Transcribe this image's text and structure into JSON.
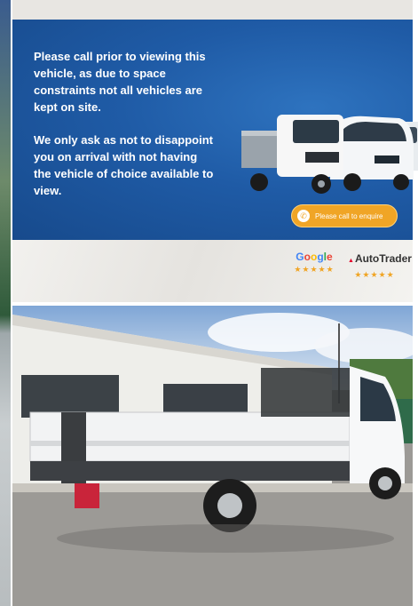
{
  "banner": {
    "paragraph_1": "Please call prior to viewing this vehicle, as due to space constraints not all vehicles are kept on site.",
    "paragraph_2": "We only ask as not to disappoint you on arrival with not having the vehicle of choice available to view.",
    "enquire_button": "Please call to enquire",
    "background_color": "#1f5ba6",
    "button_color": "#f0a526"
  },
  "ratings": {
    "google": {
      "name_letters": [
        "G",
        "o",
        "o",
        "g",
        "l",
        "e"
      ],
      "stars": "★★★★★"
    },
    "autotrader": {
      "name": "AutoTrader",
      "stars": "★★★★★"
    }
  },
  "photo": {
    "subject": "white dropside pickup truck parked in front of a building"
  },
  "icons": {
    "phone": "phone-icon",
    "star": "star-icon"
  }
}
